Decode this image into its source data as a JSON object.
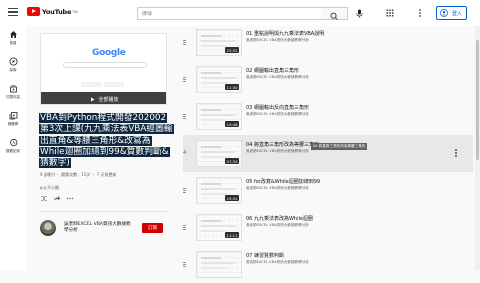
{
  "header": {
    "logo_text": "YouTube",
    "logo_region": "TW",
    "search_placeholder": "搜尋",
    "signin_label": "登入"
  },
  "nav": [
    {
      "label": "首頁",
      "icon": "home-icon"
    },
    {
      "label": "探索",
      "icon": "explore-icon"
    },
    {
      "label": "訂閱內容",
      "icon": "subscriptions-icon"
    },
    {
      "label": "媒體庫",
      "icon": "library-icon"
    },
    {
      "label": "觀看記錄",
      "icon": "history-icon"
    }
  ],
  "playlist": {
    "thumb_brand": "Google",
    "play_all_label": "全部播放",
    "title": "VBA到Python程式開發202002第3次上課(九九乘法表VBA經圖輸出直角&等腰三角形&改寫為While迴圈加總到99&質數判斷&猜數字)",
    "meta": "9 部影片・ 觀看次數：11次 ・ 7 天前更新",
    "tag": "不公開",
    "channel_name": "吳老師EXCEL VBA資訊大數據教學分析",
    "subscribe_label": "訂閱"
  },
  "videos": [
    {
      "index": "",
      "title": "01 重點說明與九九乘法表VBA說明",
      "channel": "吳老師EXCEL VBA資訊大數據教學分析",
      "duration": "23:52",
      "active": false
    },
    {
      "index": "",
      "title": "02 網圖輸出直角三角形",
      "channel": "吳老師EXCEL VBA資訊大數據教學分析",
      "duration": "11:30",
      "active": false
    },
    {
      "index": "",
      "title": "03 網圖輸出反向直角三角形",
      "channel": "吳老師EXCEL VBA資訊大數據教學分析",
      "duration": "10:48",
      "active": false
    },
    {
      "index": "4",
      "title": "04 將直角三角形改為等腰三角形",
      "channel": "吳老師EXCEL VBA資訊大數據教學分析",
      "duration": "07:34",
      "active": true,
      "tooltip": "04 將直角三角形改為等腰三角形"
    },
    {
      "index": "",
      "title": "05 for改寫&While迴圈加總到99",
      "channel": "吳老師EXCEL VBA資訊大數據教學分析",
      "duration": "15:32",
      "active": false
    },
    {
      "index": "",
      "title": "06 九九乘法表改為While迴圈",
      "channel": "吳老師EXCEL VBA資訊大數據教學分析",
      "duration": "11:11",
      "active": false
    },
    {
      "index": "",
      "title": "07 練習質數判斷",
      "channel": "吳老師EXCEL VBA資訊大數據教學分析",
      "duration": "",
      "active": false
    }
  ]
}
